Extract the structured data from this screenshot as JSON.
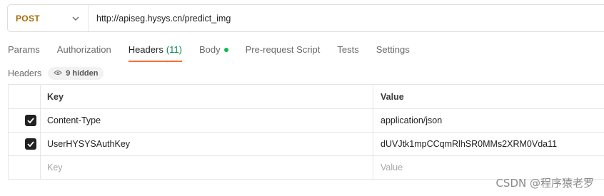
{
  "request": {
    "method": "POST",
    "url": "http://apiseg.hysys.cn/predict_img"
  },
  "tabs": [
    {
      "label": "Params"
    },
    {
      "label": "Authorization"
    },
    {
      "label": "Headers",
      "count": "(11)"
    },
    {
      "label": "Body"
    },
    {
      "label": "Pre-request Script"
    },
    {
      "label": "Tests"
    },
    {
      "label": "Settings"
    }
  ],
  "headers_section": {
    "label": "Headers",
    "hidden_text": "9 hidden"
  },
  "table": {
    "columns": {
      "key": "Key",
      "value": "Value"
    },
    "rows": [
      {
        "checked": true,
        "key": "Content-Type",
        "value": "application/json"
      },
      {
        "checked": true,
        "key": "UserHYSYSAuthKey",
        "value": "dUVJtk1mpCCqmRlhSR0MMs2XRM0Vda11"
      }
    ],
    "placeholder": {
      "key": "Key",
      "value": "Value"
    }
  },
  "watermark": "CSDN @程序猿老罗",
  "colors": {
    "accent": "#ff6c37",
    "method": "#a86b00",
    "body_dot": "#0cbb52"
  }
}
